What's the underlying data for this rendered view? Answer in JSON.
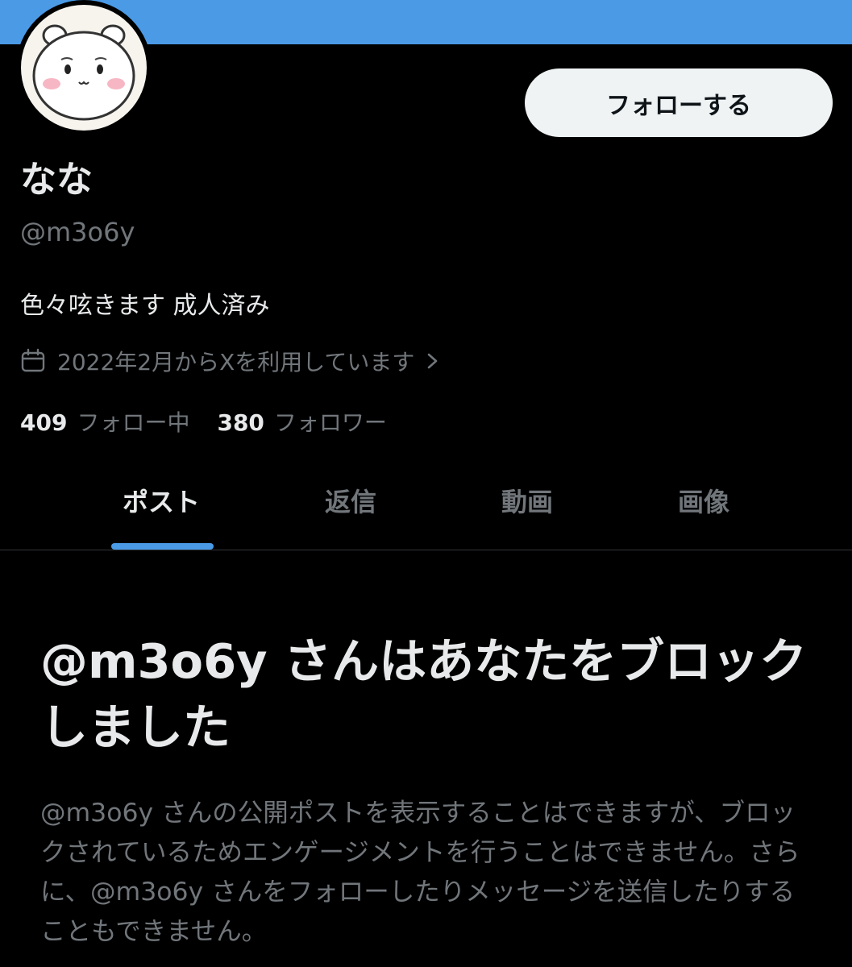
{
  "colors": {
    "banner": "#4a9ae6",
    "accent": "#4a9ae6",
    "background": "#000000",
    "muted_text": "#71767b",
    "primary_text": "#e7e9ea"
  },
  "profile": {
    "avatar_icon": "bear-face-avatar",
    "follow_button": "フォローする",
    "display_name": "なな",
    "handle": "@m3o6y",
    "bio": "色々呟きます 成人済み",
    "joined_icon": "calendar-icon",
    "joined": "2022年2月からXを利用しています",
    "joined_chevron_icon": "chevron-right-icon",
    "following_count": "409",
    "following_label": "フォロー中",
    "followers_count": "380",
    "followers_label": "フォロワー"
  },
  "tabs": [
    {
      "label": "ポスト",
      "active": true
    },
    {
      "label": "返信",
      "active": false
    },
    {
      "label": "動画",
      "active": false
    },
    {
      "label": "画像",
      "active": false
    }
  ],
  "blocked": {
    "title": "@m3o6y さんはあなたをブロックしました",
    "description": "@m3o6y さんの公開ポストを表示することはできますが、ブロックされているためエンゲージメントを行うことはできません。さらに、@m3o6y さんをフォローしたりメッセージを送信したりすることもできません。"
  }
}
